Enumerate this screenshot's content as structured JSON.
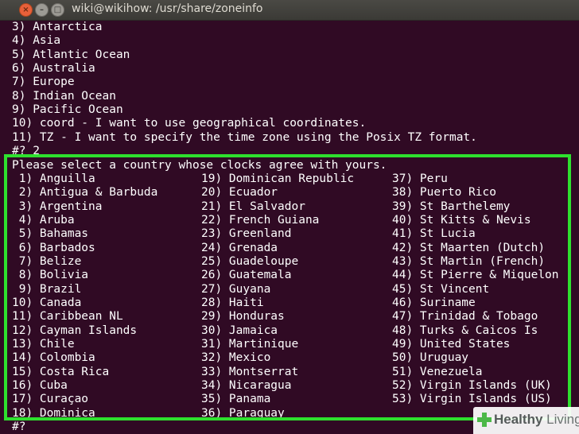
{
  "window": {
    "title": "wiki@wikihow: /usr/share/zoneinfo"
  },
  "terminal": {
    "prev_lines": [
      "3) Antarctica",
      "4) Asia",
      "5) Atlantic Ocean",
      "6) Australia",
      "7) Europe",
      "8) Indian Ocean",
      "9) Pacific Ocean",
      "10) coord - I want to use geographical coordinates.",
      "11) TZ - I want to specify the time zone using the Posix TZ format.",
      "#? 2"
    ],
    "prompt_header": "Please select a country whose clocks agree with yours.",
    "col1": [
      " 1) Anguilla",
      " 2) Antigua & Barbuda",
      " 3) Argentina",
      " 4) Aruba",
      " 5) Bahamas",
      " 6) Barbados",
      " 7) Belize",
      " 8) Bolivia",
      " 9) Brazil",
      "10) Canada",
      "11) Caribbean NL",
      "12) Cayman Islands",
      "13) Chile",
      "14) Colombia",
      "15) Costa Rica",
      "16) Cuba",
      "17) Curaçao",
      "18) Dominica"
    ],
    "col2": [
      "19) Dominican Republic",
      "20) Ecuador",
      "21) El Salvador",
      "22) French Guiana",
      "23) Greenland",
      "24) Grenada",
      "25) Guadeloupe",
      "26) Guatemala",
      "27) Guyana",
      "28) Haiti",
      "29) Honduras",
      "30) Jamaica",
      "31) Martinique",
      "32) Mexico",
      "33) Montserrat",
      "34) Nicaragua",
      "35) Panama",
      "36) Paraguay"
    ],
    "col3": [
      "37) Peru",
      "38) Puerto Rico",
      "39) St Barthelemy",
      "40) St Kitts & Nevis",
      "41) St Lucia",
      "42) St Maarten (Dutch)",
      "43) St Martin (French)",
      "44) St Pierre & Miquelon",
      "45) St Vincent",
      "46) Suriname",
      "47) Trinidad & Tobago",
      "48) Turks & Caicos Is",
      "49) United States",
      "50) Uruguay",
      "51) Venezuela",
      "52) Virgin Islands (UK)",
      "53) Virgin Islands (US)"
    ],
    "final_prompt": "#? "
  },
  "watermark": {
    "brand_bold": "Healthy",
    "brand_light": " Living",
    "icon": "plus-icon",
    "accent": "#4cb848"
  },
  "colors": {
    "terminal_bg": "#300a24",
    "terminal_fg": "#ffffff",
    "highlight_border": "#2ee02e"
  }
}
